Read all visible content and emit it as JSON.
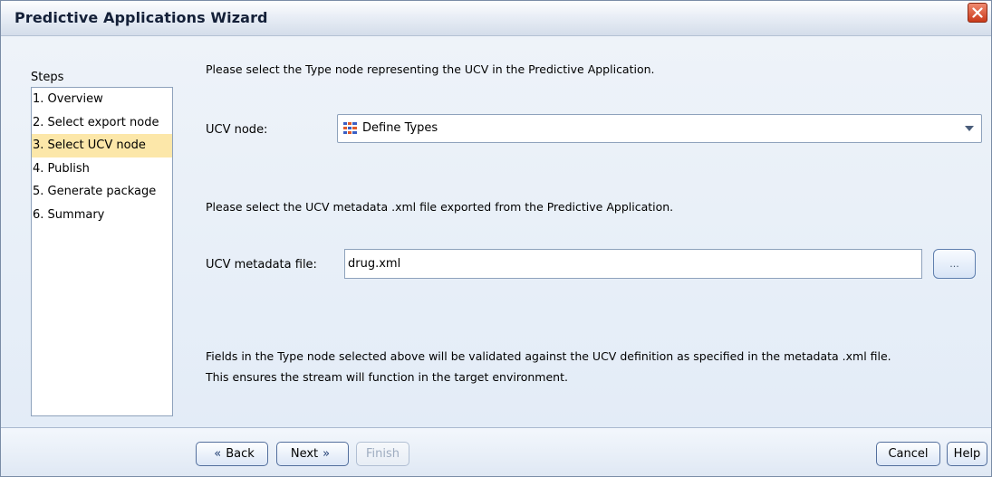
{
  "window": {
    "title": "Predictive Applications Wizard"
  },
  "steps": {
    "heading": "Steps",
    "items": [
      {
        "label": "1. Overview",
        "active": false
      },
      {
        "label": "2. Select export node",
        "active": false
      },
      {
        "label": "3. Select UCV node",
        "active": true
      },
      {
        "label": "4. Publish",
        "active": false
      },
      {
        "label": "5. Generate package",
        "active": false
      },
      {
        "label": "6. Summary",
        "active": false
      }
    ]
  },
  "main": {
    "instruction_type": "Please select the Type node representing the UCV in the Predictive Application.",
    "ucv_node_label": "UCV node:",
    "ucv_node_value": "Define Types",
    "instruction_metadata": "Please select the UCV metadata .xml file exported from the Predictive Application.",
    "metadata_label": "UCV metadata file:",
    "metadata_value": "drug.xml",
    "browse_label": "...",
    "note_line1": "Fields in the Type node selected above will be validated against the UCV definition as specified in the metadata .xml file.",
    "note_line2": "This ensures the stream will function in the target environment."
  },
  "footer": {
    "back_label": "Back",
    "next_label": "Next",
    "finish_label": "Finish",
    "cancel_label": "Cancel",
    "help_label": "Help"
  },
  "colors": {
    "active_step": "#fce7a9",
    "close_button": "#d9482a",
    "window_bg": "#e2ebf6"
  },
  "icons": {
    "close": "close-icon",
    "type_node": "type-node-icon",
    "dropdown": "chevron-down-icon",
    "back": "double-chevron-left-icon",
    "next": "double-chevron-right-icon"
  }
}
